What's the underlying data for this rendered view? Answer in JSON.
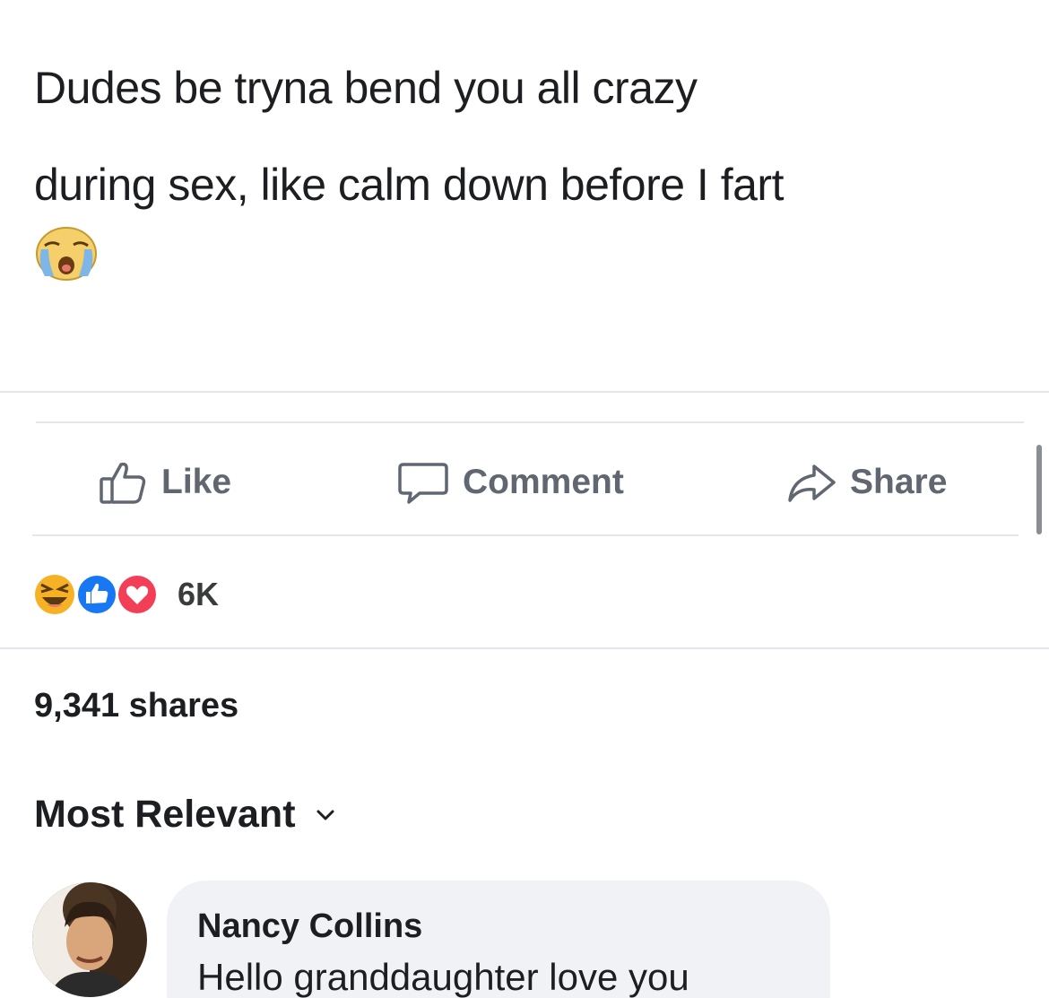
{
  "post": {
    "text_lines": [
      "Dudes be tryna bend you all crazy",
      "during sex, like calm down before I fart"
    ],
    "emoji": "loudly-crying-face"
  },
  "actions": {
    "like_label": "Like",
    "comment_label": "Comment",
    "share_label": "Share"
  },
  "reactions": {
    "icons": [
      "haha-reaction-icon",
      "like-reaction-icon",
      "love-reaction-icon"
    ],
    "count": "6K"
  },
  "shares": {
    "label": "9,341 shares"
  },
  "comments": {
    "sort_label": "Most Relevant",
    "items": [
      {
        "author": "Nancy Collins",
        "text": "Hello granddaughter love you"
      }
    ]
  },
  "colors": {
    "action_gray": "#606770",
    "bubble_bg": "#f0f2f5",
    "like_blue": "#1877f2",
    "love_red": "#f33e58",
    "haha_yellow": "#f7b125"
  }
}
